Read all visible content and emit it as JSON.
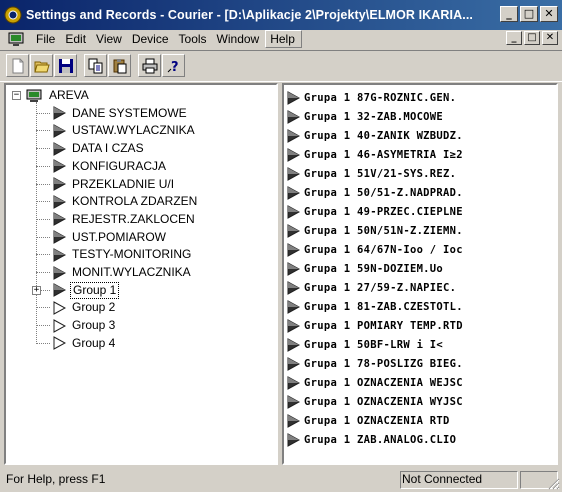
{
  "window": {
    "title": "Settings and Records - Courier - [D:\\Aplikacje 2\\Projekty\\ELMOR IKARIA...",
    "caption_minimize": "_",
    "caption_maximize": "□",
    "caption_close": "✕"
  },
  "menu": {
    "items": [
      "File",
      "Edit",
      "View",
      "Device",
      "Tools",
      "Window",
      "Help"
    ],
    "active": "Help"
  },
  "toolbar": {
    "buttons": [
      "new-icon",
      "open-icon",
      "save-icon",
      "copy-icon",
      "paste-icon",
      "print-icon",
      "help-icon"
    ]
  },
  "tree": {
    "root": "AREVA",
    "items": [
      "DANE SYSTEMOWE",
      "USTAW.WYLACZNIKA",
      "DATA I CZAS",
      "KONFIGURACJA",
      "PRZEKLADNIE U/I",
      "KONTROLA ZDARZEN",
      "REJESTR.ZAKLOCEN",
      "UST.POMIAROW",
      "TESTY-MONITORING",
      "MONIT.WYLACZNIKA",
      "Group 1",
      "Group 2",
      "Group 3",
      "Group 4"
    ],
    "selected": "Group 1",
    "expander_plus": "+",
    "expander_minus": "−"
  },
  "list": {
    "items": [
      "Grupa 1 87G-ROZNIC.GEN.",
      "Grupa 1 32-ZAB.MOCOWE",
      "Grupa 1 40-ZANIK WZBUDZ.",
      "Grupa 1 46-ASYMETRIA I≥2",
      "Grupa 1 51V/21-SYS.REZ.",
      "Grupa 1 50/51-Z.NADPRAD.",
      "Grupa 1 49-PRZEC.CIEPLNE",
      "Grupa 1 50N/51N-Z.ZIEMN.",
      "Grupa 1 64/67N-Ioo / Ioc",
      "Grupa 1 59N-DOZIEM.Uo",
      "Grupa 1 27/59-Z.NAPIEC.",
      "Grupa 1 81-ZAB.CZESTOTL.",
      "Grupa 1 POMIARY TEMP.RTD",
      "Grupa 1 50BF-LRW i I<",
      "Grupa 1 78-POSLIZG BIEG.",
      "Grupa 1 OZNACZENIA WEJSC",
      "Grupa 1 OZNACZENIA WYJSC",
      "Grupa 1 OZNACZENIA RTD",
      "Grupa 1 ZAB.ANALOG.CLIO"
    ]
  },
  "status": {
    "help_text": "For Help, press F1",
    "connection": "Not Connected"
  },
  "colors": {
    "titlebar_start": "#0a246a",
    "titlebar_end": "#3a6ea5",
    "face": "#d4d0c8"
  }
}
